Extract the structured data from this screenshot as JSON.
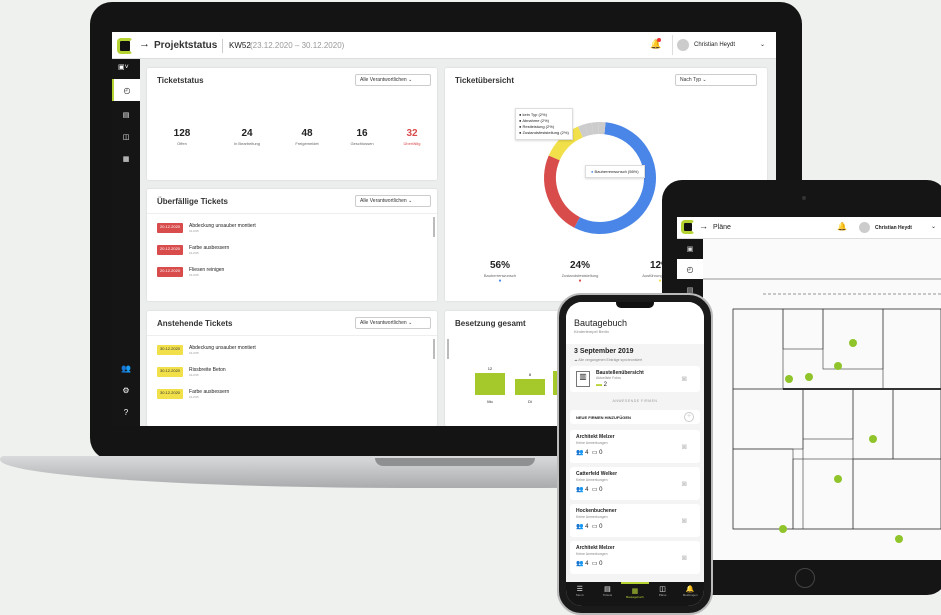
{
  "laptop": {
    "header": {
      "title": "Projektstatus",
      "week": "KW52",
      "range": "(23.12.2020 – 30.12.2020)",
      "user": "Christian Heydt"
    },
    "ticketstatus": {
      "title": "Ticketstatus",
      "filter": "Alle Verantwortlichen",
      "stats": [
        {
          "n": "128",
          "l": "Offen"
        },
        {
          "n": "24",
          "l": "In Bearbeitung"
        },
        {
          "n": "48",
          "l": "Freigemeldet"
        },
        {
          "n": "16",
          "l": "Geschlossen"
        },
        {
          "n": "32",
          "l": "Überfällig"
        }
      ]
    },
    "overdue": {
      "title": "Überfällige Tickets",
      "filter": "Alle Verantwortlichen",
      "items": [
        {
          "date": "20.12.2020",
          "text": "Abdeckung unsauber montiert",
          "sub": "01-K65"
        },
        {
          "date": "20.12.2020",
          "text": "Farbe ausbessern",
          "sub": "01-K65"
        },
        {
          "date": "20.12.2020",
          "text": "Fliesen reinigen",
          "sub": "01-K65"
        }
      ]
    },
    "upcoming": {
      "title": "Anstehende Tickets",
      "filter": "Alle Verantwortlichen",
      "items": [
        {
          "date": "30.12.2020",
          "text": "Abdeckung unsauber montiert",
          "sub": "01-K65"
        },
        {
          "date": "30.12.2020",
          "text": "Rissbreite Beton",
          "sub": "01-K65"
        },
        {
          "date": "30.12.2020",
          "text": "Farbe ausbessern",
          "sub": "01-K65"
        }
      ]
    },
    "overview": {
      "title": "Ticketübersicht",
      "filter": "Nach Typ",
      "legend": [
        "kein Typ (2%)",
        "Abnahme (2%)",
        "Restleistung (2%)",
        "Zustandsfeststellung (2%)"
      ],
      "tooltip": "Bauherrenwunsch (56%)",
      "totals": [
        {
          "n": "56%",
          "l": "Bauherrenwunsch",
          "c": "#4a86e8"
        },
        {
          "n": "24%",
          "l": "Zustandsfeststellung",
          "c": "#d84c4c"
        },
        {
          "n": "12%",
          "l": "Ausführungsmangel",
          "c": "#f1e04a"
        }
      ]
    },
    "besetzung": {
      "title": "Besetzung gesamt",
      "bars": [
        {
          "v": "12",
          "d": "Mo"
        },
        {
          "v": "8",
          "d": "Di"
        },
        {
          "v": "",
          "d": ""
        }
      ]
    }
  },
  "chart_data": {
    "type": "pie",
    "categories": [
      "Bauherrenwunsch",
      "Zustandsfeststellung",
      "Ausführungsmangel",
      "kein Typ",
      "Abnahme",
      "Restleistung",
      "Zustandsfeststellung"
    ],
    "values": [
      56,
      24,
      12,
      2,
      2,
      2,
      2
    ],
    "colors": [
      "#4a86e8",
      "#d84c4c",
      "#f1e04a",
      "#cccccc",
      "#cccccc",
      "#cccccc",
      "#cccccc"
    ]
  },
  "tablet": {
    "title": "Pläne",
    "user": "Christian Heydt"
  },
  "phone": {
    "title": "Bautagebuch",
    "subtitle": "Kindertempel Berlin",
    "date": "3 September 2019",
    "sync": "Alle vergangenen Einträge synchronisiert",
    "site": {
      "title": "Baustellenübersicht",
      "sub": "Aktuellste Fotos",
      "count": "2"
    },
    "section": "ANWESENDE FIRMEN",
    "add": "NEUE FIRMEN HINZUFÜGEN",
    "firms": [
      {
        "name": "Architekt Melzer",
        "note": "Keine Anmerkungen",
        "a": "4",
        "b": "0"
      },
      {
        "name": "Catterfeld Welker",
        "note": "Keine Anmerkungen",
        "a": "4",
        "b": "0"
      },
      {
        "name": "Hockenbuchener",
        "note": "Keine Anmerkungen",
        "a": "4",
        "b": "0"
      },
      {
        "name": "Architekt Melzer",
        "note": "Keine Anmerkungen",
        "a": "4",
        "b": "0"
      }
    ],
    "nav": [
      "Menü",
      "Tickets",
      "Bautagebuch",
      "Pläne",
      "Meldungen"
    ]
  }
}
